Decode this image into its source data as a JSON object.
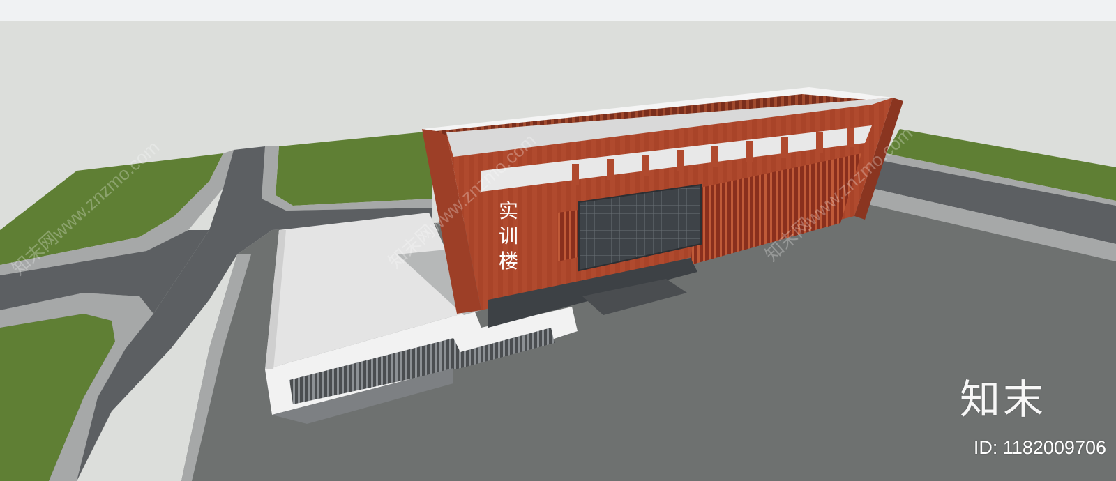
{
  "scene": {
    "building_sign": [
      "实",
      "训",
      "楼"
    ],
    "watermark_text": "知末网www.znzmo.com",
    "logo_text": "知末",
    "id_label": "ID: 1182009706"
  },
  "colors": {
    "sky": "#dcdedb",
    "grass": "#5f7f34",
    "road": "#5c5f62",
    "curb": "#a6a8a8",
    "plaza": "#6e7170",
    "brick": "#b04a2e",
    "glass": "#3b3f44",
    "white_wall": "#f2f2f2"
  }
}
